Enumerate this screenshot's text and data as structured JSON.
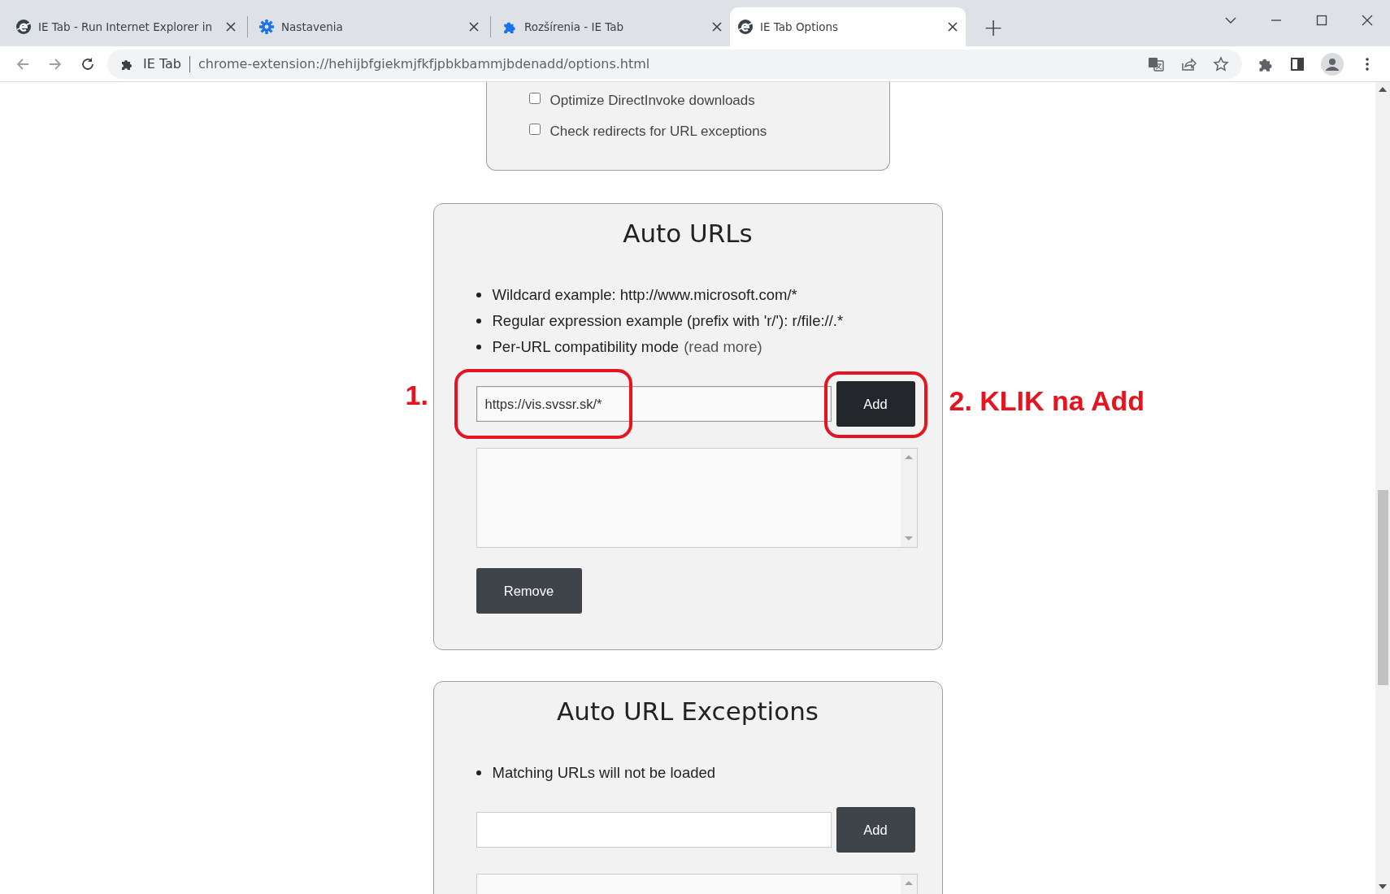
{
  "browser": {
    "tabs": [
      {
        "title": "IE Tab - Run Internet Explorer in",
        "kind": "ie",
        "selected": false
      },
      {
        "title": "Nastavenia",
        "kind": "settings",
        "selected": false
      },
      {
        "title": "Rozšírenia - IE Tab",
        "kind": "extension",
        "selected": false
      },
      {
        "title": "IE Tab Options",
        "kind": "ie",
        "selected": true
      }
    ],
    "new_tab": "+",
    "address_bar": {
      "chip": "IE Tab",
      "url": "chrome-extension://hehijbfgiekmjfkfjpbkbammjbdenadd/options.html"
    }
  },
  "partial_section": {
    "checkboxes": [
      {
        "label": "Optimize DirectInvoke downloads",
        "checked": false
      },
      {
        "label": "Check redirects for URL exceptions",
        "checked": false
      }
    ]
  },
  "sections": [
    {
      "title": "Auto URLs",
      "bullets": [
        {
          "text": "Wildcard example: http://www.microsoft.com/*"
        },
        {
          "text": "Regular expression example (prefix with 'r/'): r/file://.*"
        },
        {
          "text": "Per-URL compatibility mode",
          "link": "(read more)"
        }
      ],
      "input": {
        "value": "https://vis.svssr.sk/*",
        "focused": true
      },
      "add_button": {
        "label": "Add",
        "hovered": true
      },
      "remove_button": {
        "label": "Remove"
      }
    },
    {
      "title": "Auto URL Exceptions",
      "bullets": [
        {
          "text": "Matching URLs will not be loaded"
        }
      ],
      "input": {
        "focused": false
      },
      "add_button": {
        "label": "Add",
        "hovered": false
      }
    }
  ],
  "annotations": [
    {
      "text": "1.",
      "kind": "field"
    },
    {
      "text": "2. KLIK na Add",
      "kind": "button"
    }
  ]
}
